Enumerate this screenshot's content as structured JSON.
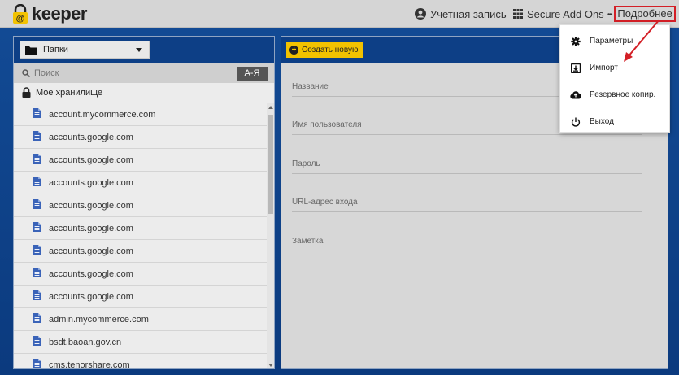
{
  "app": {
    "logo_text": "keeper",
    "logo_at": "@"
  },
  "topbar": {
    "account_label": "Учетная запись",
    "secure_addons_label": "Secure Add Ons",
    "more_label": "Подробнее",
    "more_dots": "•••"
  },
  "left": {
    "folder_select": "Папки",
    "search_placeholder": "Поиск",
    "sort_label": "А-Я",
    "vault_label": "Мое хранилище",
    "records": [
      "account.mycommerce.com",
      "accounts.google.com",
      "accounts.google.com",
      "accounts.google.com",
      "accounts.google.com",
      "accounts.google.com",
      "accounts.google.com",
      "accounts.google.com",
      "accounts.google.com",
      "admin.mycommerce.com",
      "bsdt.baoan.gov.cn",
      "cms.tenorshare.com"
    ]
  },
  "right": {
    "create_label": "Создать новую",
    "fields": {
      "name": "Название",
      "username": "Имя пользователя",
      "password": "Пароль",
      "url": "URL-адрес входа",
      "note": "Заметка"
    }
  },
  "dropdown": {
    "items": [
      {
        "label": "Параметры",
        "icon": "gear-icon"
      },
      {
        "label": "Импорт",
        "icon": "import-icon"
      },
      {
        "label": "Резервное копир.",
        "icon": "cloud-upload-icon"
      },
      {
        "label": "Выход",
        "icon": "power-icon"
      }
    ]
  },
  "colors": {
    "brand_blue": "#0d3f86",
    "accent_yellow": "#f2c200",
    "highlight_red": "#d31f26"
  }
}
